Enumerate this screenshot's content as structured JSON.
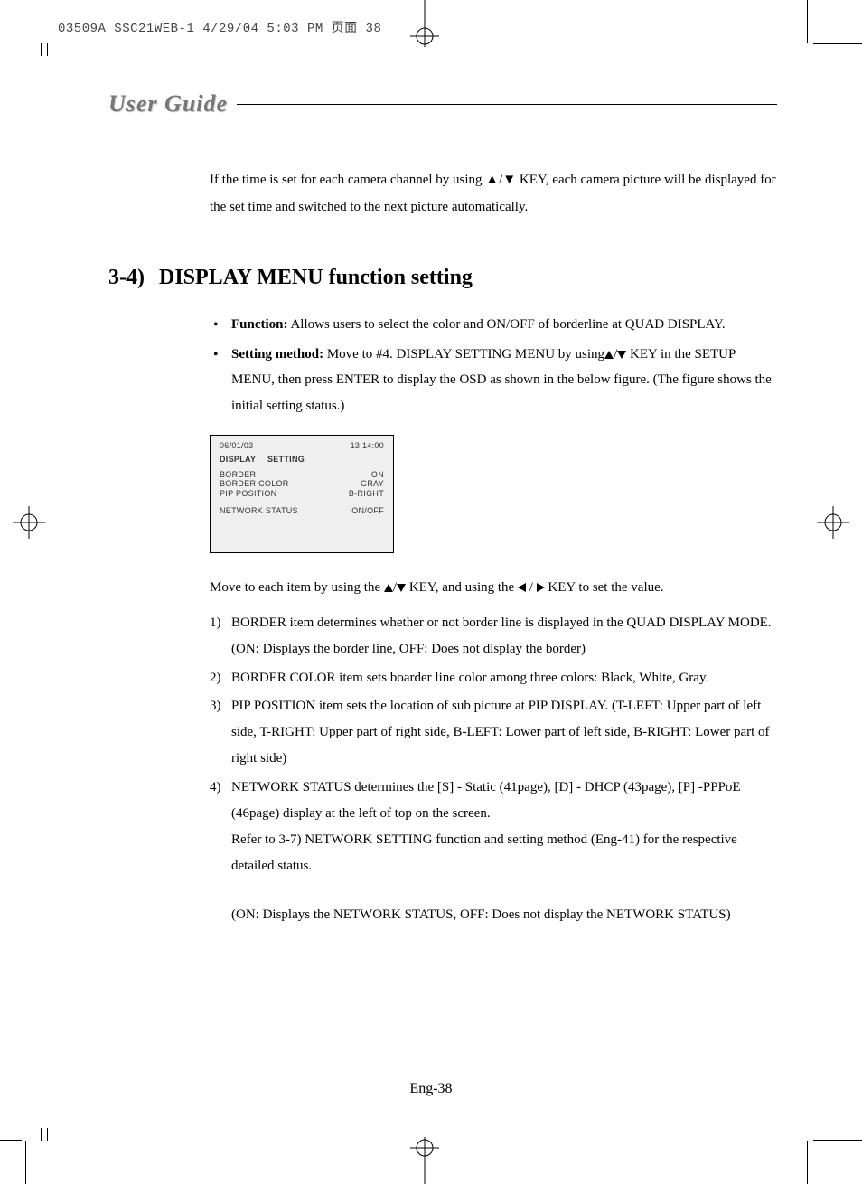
{
  "slug": "03509A SSC21WEB-1  4/29/04  5:03 PM  页面 38",
  "header": "User Guide",
  "intro": "If the time is set for each camera channel by using ▲/▼ KEY, each camera picture will be displayed for the set time and switched to the next picture automatically.",
  "section": {
    "num": "3-4)",
    "title": "DISPLAY MENU function setting"
  },
  "bullets": {
    "fn_label": "Function:",
    "fn_text": " Allows users to select the color and ON/OFF of borderline at QUAD DISPLAY.",
    "sm_label": "Setting method:",
    "sm_text_a": " Move to #4. DISPLAY SETTING MENU by using",
    "sm_text_b": " KEY in the SETUP MENU, then press  ENTER  to display the OSD as shown in the below  figure. (The figure shows the initial setting status.)"
  },
  "osd": {
    "date": "06/01/03",
    "time": "13:14:00",
    "title_a": "DISPLAY",
    "title_b": "SETTING",
    "rows": [
      {
        "l": "BORDER",
        "r": "ON"
      },
      {
        "l": "BORDER COLOR",
        "r": "GRAY"
      },
      {
        "l": "PIP POSITION",
        "r": "B-RIGHT"
      }
    ],
    "net_l": "NETWORK STATUS",
    "net_r": "ON/OFF"
  },
  "move_a": "Move to each item by using the ",
  "move_b": " KEY, and using the ",
  "move_c": "KEY to set the value.",
  "items": {
    "i1n": "1)",
    "i1": "BORDER item determines whether or not border line is displayed in the QUAD DISPLAY MODE. (ON: Displays the border  line, OFF: Does not display the border)",
    "i2n": "2)",
    "i2": "BORDER COLOR item sets boarder line color among three colors: Black, White, Gray.",
    "i3n": "3)",
    "i3": "PIP POSITION item sets the location of sub picture at PIP DISPLAY. (T-LEFT: Upper part of left side, T-RIGHT: Upper part of right side, B-LEFT: Lower part of left side, B-RIGHT: Lower part of right side)",
    "i4n": "4)",
    "i4a": "NETWORK STATUS determines the  [S] - Static (41page), [D] - DHCP (43page), [P] -PPPoE (46page) display  at the left of top on the screen.",
    "i4b": "Refer to 3-7) NETWORK SETTING function and setting method (Eng-41)  for the respective detailed status.",
    "i4c": "(ON: Displays the NETWORK STATUS, OFF: Does not display the NETWORK STATUS)"
  },
  "footer": "Eng-38"
}
